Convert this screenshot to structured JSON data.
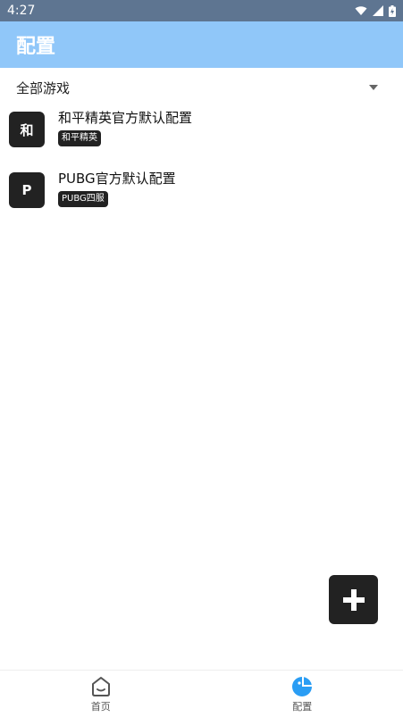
{
  "status_bar": {
    "time": "4:27"
  },
  "app_bar": {
    "title": "配置"
  },
  "filter": {
    "selected": "全部游戏"
  },
  "configs": [
    {
      "avatar": "和",
      "title": "和平精英官方默认配置",
      "tag": "和平精英"
    },
    {
      "avatar": "P",
      "title": "PUBG官方默认配置",
      "tag": "PUBG四服"
    }
  ],
  "fab": {
    "icon": "plus-icon"
  },
  "bottom_nav": {
    "items": [
      {
        "label": "首页",
        "icon": "home-icon"
      },
      {
        "label": "配置",
        "icon": "config-icon",
        "active": true
      }
    ]
  },
  "colors": {
    "status_bar": "#5e7591",
    "app_bar": "#90c7f9",
    "accent": "#2a9df4",
    "dark": "#222222"
  }
}
